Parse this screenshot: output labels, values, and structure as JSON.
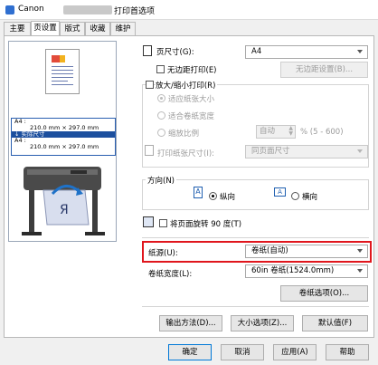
{
  "window": {
    "title_left": "Canon",
    "title_right": "打印首选项"
  },
  "tabs": [
    "主要",
    "页设置",
    "版式",
    "收藏",
    "维护"
  ],
  "preview": {
    "size_lines": [
      "A4 :",
      "210.0 mm × 297.0 mm",
      "实际尺寸",
      "A4 :",
      "210.0 mm × 297.0 mm"
    ]
  },
  "page_size": {
    "label": "页尺寸(G):",
    "value": "A4"
  },
  "borderless": {
    "label": "无边距打印(E)",
    "button": "无边距设置(B)..."
  },
  "scaling": {
    "label": "放大/缩小打印(R)",
    "option1": "适应纸张大小",
    "option2": "适合卷纸宽度",
    "option3": "缩放比例",
    "scale_value": "自动",
    "scale_range": "% (5 - 600)",
    "print_size_label": "打印纸张尺寸(I):",
    "print_size_value": "同页面尺寸"
  },
  "orientation": {
    "label": "方向(N)",
    "portrait": "纵向",
    "landscape": "横向"
  },
  "rotate": {
    "label": "将页面旋转 90 度(T)"
  },
  "paper_source": {
    "label": "纸源(U):",
    "value": "卷纸(自动)"
  },
  "roll_width": {
    "label": "卷纸宽度(L):",
    "value": "60in 卷纸(1524.0mm)"
  },
  "roll_options_button": "卷纸选项(O)...",
  "bottom_row": {
    "output": "输出方法(D)...",
    "size_options": "大小选项(Z)...",
    "defaults": "默认值(F)"
  },
  "dialog": {
    "ok": "确定",
    "cancel": "取消",
    "apply": "应用(A)",
    "help": "帮助"
  }
}
